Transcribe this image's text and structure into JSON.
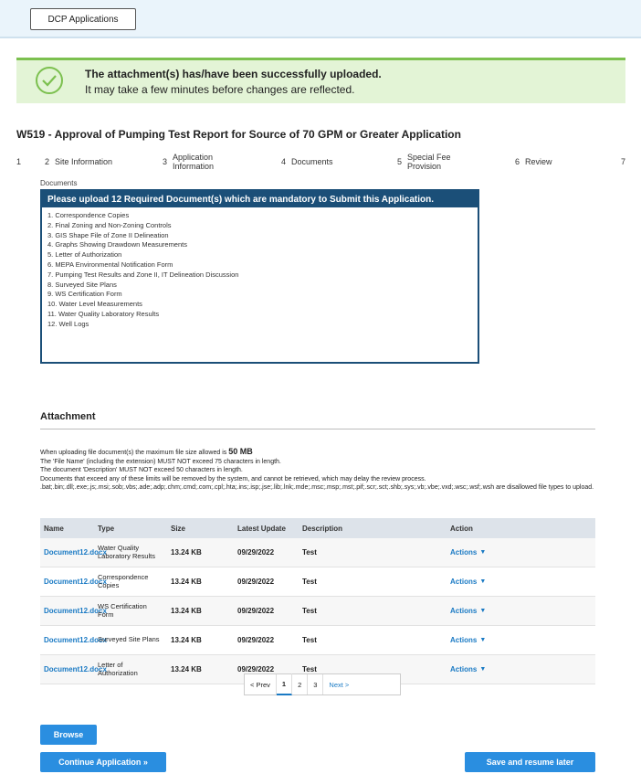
{
  "topbar": {
    "dcp_button": "DCP Applications"
  },
  "alert": {
    "line1": "The attachment(s) has/have been successfully uploaded.",
    "line2": "It may take a few minutes before changes are reflected.",
    "icon": "check-circle-icon",
    "color": "#7cc04f"
  },
  "page_title": "W519 - Approval of Pumping Test Report for Source of 70 GPM or Greater Application",
  "steps": [
    {
      "num": "1",
      "label": ""
    },
    {
      "num": "2",
      "label": "Site Information"
    },
    {
      "num": "3",
      "label": "Application Information"
    },
    {
      "num": "4",
      "label": "Documents"
    },
    {
      "num": "5",
      "label": "Special Fee Provision"
    },
    {
      "num": "6",
      "label": "Review"
    },
    {
      "num": "7",
      "label": ""
    }
  ],
  "documents": {
    "caption": "Documents",
    "header": "Please upload 12 Required Document(s) which are mandatory to Submit this Application.",
    "items": [
      "1. Correspondence Copies",
      "2. Final Zoning and Non-Zoning Controls",
      "3. GIS Shape File of Zone II Delineation",
      "4. Graphs Showing Drawdown Measurements",
      "5. Letter of Authorization",
      "6. MEPA Environmental Notification Form",
      "7. Pumping Test Results and Zone II, IT Delineation Discussion",
      "8. Surveyed Site Plans",
      "9. WS Certification Form",
      "10. Water Level Measurements",
      "11. Water Quality Laboratory Results",
      "12. Well Logs"
    ]
  },
  "attachment": {
    "title": "Attachment",
    "instr1_pre": "When uploading file document(s) the maximum file size allowed is ",
    "instr1_size": "50 MB",
    "instr2": "The 'File Name' (including the extension) MUST NOT exceed 75 characters in length.",
    "instr3": "The document 'Description' MUST NOT exceed 50 characters in length.",
    "instr4": "Documents that exceed any of these limits will be removed by the system, and cannot be retrieved, which may delay the review process.",
    "instr5": ".bat;.bin;.dll;.exe;.js;.msi;.sob;.vbs;.ade;.adp;.chm;.cmd;.com;.cpl;.hta;.ins;.isp;.jse;.lib;.lnk;.mde;.msc;.msp;.mst;.pif;.scr;.sct;.shb;.sys;.vb;.vbe;.vxd;.wsc;.wsf;.wsh are disallowed file types to upload.",
    "columns": [
      "Name",
      "Type",
      "Size",
      "Latest Update",
      "Description",
      "Action"
    ],
    "rows": [
      {
        "name": "Document12.docx",
        "type": "Water Quality Laboratory Results",
        "size": "13.24 KB",
        "date": "09/29/2022",
        "desc": "Test",
        "action": "Actions"
      },
      {
        "name": "Document12.docx",
        "type": "Correspondence Copies",
        "size": "13.24 KB",
        "date": "09/29/2022",
        "desc": "Test",
        "action": "Actions"
      },
      {
        "name": "Document12.docx",
        "type": "WS Certification Form",
        "size": "13.24 KB",
        "date": "09/29/2022",
        "desc": "Test",
        "action": "Actions"
      },
      {
        "name": "Document12.docx",
        "type": "Surveyed Site Plans",
        "size": "13.24 KB",
        "date": "09/29/2022",
        "desc": "Test",
        "action": "Actions"
      },
      {
        "name": "Document12.docx",
        "type": "Letter of Authorization",
        "size": "13.24 KB",
        "date": "09/29/2022",
        "desc": "Test",
        "action": "Actions"
      }
    ]
  },
  "pager": {
    "prev": "< Prev",
    "pages": [
      "1",
      "2",
      "3"
    ],
    "next": "Next >"
  },
  "buttons": {
    "browse": "Browse",
    "continue": "Continue Application »",
    "save": "Save and resume later"
  }
}
